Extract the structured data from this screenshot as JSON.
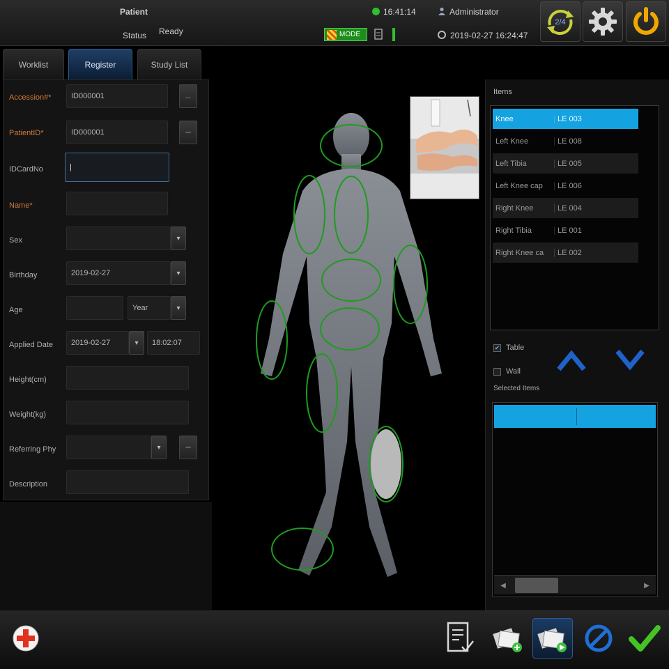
{
  "topbar": {
    "title": "Patient",
    "status_label": "Status",
    "status_value": "Ready",
    "time": "16:41:14",
    "user": "Administrator",
    "datetime": "2019-02-27 16:24:47",
    "mode_label": "MODE",
    "counter": "2/4"
  },
  "tabs": [
    {
      "label": "Worklist"
    },
    {
      "label": "Register"
    },
    {
      "label": "Study List"
    }
  ],
  "form": {
    "accession_label": "Accession#*",
    "accession_value": "ID000001",
    "accession_btn": "...",
    "patient_id_label": "PatientID*",
    "patient_id_value": "ID000001",
    "id_card_label": "IDCardNo",
    "name_label": "Name*",
    "sex_label": "Sex",
    "birthday_label": "Birthday",
    "birthday_value": "2019-02-27",
    "age_label": "Age",
    "age_unit": "Year",
    "applied_label": "Applied Date",
    "applied_date": "2019-02-27",
    "applied_time": "18:02:07",
    "height_label": "Height(cm)",
    "weight_label": "Weight(kg)",
    "ref_phy_label": "Referring Phy",
    "description_label": "Description"
  },
  "items": {
    "title": "Items",
    "rows": [
      {
        "name": "Knee",
        "code": "LE 003"
      },
      {
        "name": "Left Knee",
        "code": "LE 008"
      },
      {
        "name": "Left Tibia",
        "code": "LE 005"
      },
      {
        "name": "Left Knee cap",
        "code": "LE 006"
      },
      {
        "name": "Right Knee",
        "code": "LE 004"
      },
      {
        "name": "Right Tibia",
        "code": "LE 001"
      },
      {
        "name": "Right Knee ca",
        "code": "LE 002"
      }
    ],
    "selected_index": 0
  },
  "position": {
    "table_label": "Table",
    "wall_label": "Wall",
    "table_checked": true,
    "wall_checked": false
  },
  "selected_items": {
    "title": "Selected Items"
  },
  "colors": {
    "accent_blue": "#14a3e0",
    "region_outline": "#1f9b1f",
    "required_label": "#d07a3a",
    "confirm_green": "#44c424",
    "emergency_red": "#e0301e"
  }
}
